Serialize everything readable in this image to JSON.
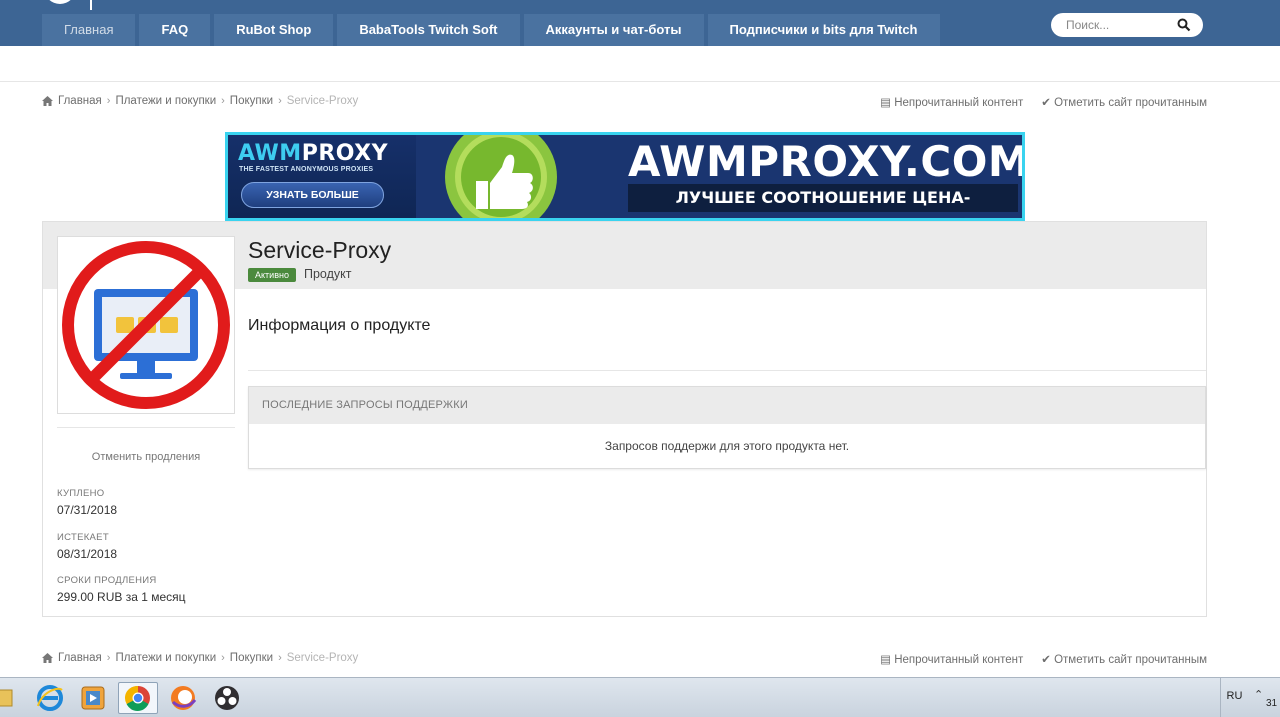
{
  "nav": {
    "items": [
      "Главная",
      "FAQ",
      "RuBot Shop",
      "BabaTools Twitch Soft",
      "Аккаунты и чат-боты",
      "Подписчики и bits для Twitch"
    ],
    "search_placeholder": "Поиск..."
  },
  "breadcrumbs": {
    "items": [
      "Главная",
      "Платежи и покупки",
      "Покупки"
    ],
    "current": "Service-Proxy"
  },
  "site_actions": {
    "unread": "Непрочитанный контент",
    "mark_read": "Отметить сайт прочитанным"
  },
  "banner": {
    "logo_mark": "AWM",
    "logo_word": "PROXY",
    "subtitle": "THE FASTEST ANONYMOUS PROXIES",
    "button": "УЗНАТЬ БОЛЬШЕ",
    "domain": "AWMPROXY.COM",
    "tagline": "ЛУЧШЕЕ СООТНОШЕНИЕ ЦЕНА-КАЧЕСТВО"
  },
  "product": {
    "title": "Service-Proxy",
    "status": "Активно",
    "type": "Продукт",
    "info_heading": "Информация о продукте",
    "cancel_renewal": "Отменить продления"
  },
  "support": {
    "heading": "ПОСЛЕДНИЕ ЗАПРОСЫ ПОДДЕРЖКИ",
    "empty": "Запросов поддержи для этого продукта нет."
  },
  "meta": {
    "purchased_label": "КУПЛЕНО",
    "purchased_value": "07/31/2018",
    "expires_label": "ИСТЕКАЕТ",
    "expires_value": "08/31/2018",
    "renewal_label": "СРОКИ ПРОДЛЕНИЯ",
    "renewal_value": "299.00 RUB за 1 месяц"
  },
  "taskbar": {
    "lang": "RU",
    "clock": "31"
  },
  "colors": {
    "nav_bg": "#3d6594",
    "status_green": "#4b8a3d",
    "banner_border": "#39d3ef"
  }
}
